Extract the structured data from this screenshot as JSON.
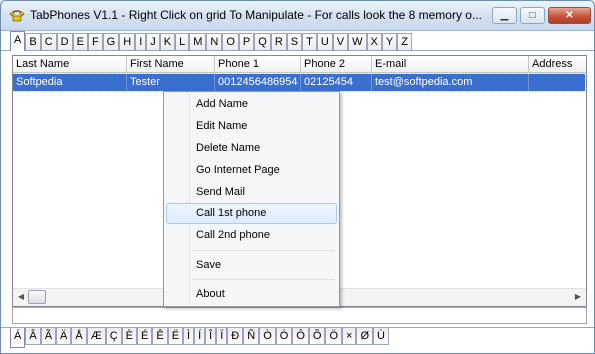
{
  "window": {
    "title": "TabPhones  V1.1  - Right Click on grid To Manipulate - For calls look the 8 memory o...",
    "minimize_label": "▁",
    "maximize_label": "□",
    "close_label": "✕"
  },
  "top_tabs": [
    "A",
    "B",
    "C",
    "D",
    "E",
    "F",
    "G",
    "H",
    "I",
    "J",
    "K",
    "L",
    "M",
    "N",
    "O",
    "P",
    "Q",
    "R",
    "S",
    "T",
    "U",
    "V",
    "W",
    "X",
    "Y",
    "Z"
  ],
  "grid": {
    "columns": [
      "Last Name",
      "First Name",
      "Phone 1",
      "Phone 2",
      "E-mail",
      "Address"
    ],
    "row": [
      "Softpedia",
      "Tester",
      "0012456486954",
      "02125454",
      "test@softpedia.com",
      ""
    ]
  },
  "scrollbar": {
    "left_arrow": "◀",
    "right_arrow": "▶"
  },
  "context_menu": {
    "items": [
      "Add Name",
      "Edit Name",
      "Delete Name",
      "Go Internet Page",
      "Send Mail",
      "Call 1st phone",
      "Call 2nd phone",
      "Save",
      "About"
    ]
  },
  "bottom_tabs": [
    "Á",
    "Â",
    "Ã",
    "Ä",
    "Å",
    "Æ",
    "Ç",
    "È",
    "É",
    "Ê",
    "Ë",
    "Ì",
    "Í",
    "Î",
    "Ï",
    "Ð",
    "Ñ",
    "Ò",
    "Ó",
    "Ô",
    "Õ",
    "Ö",
    "×",
    "Ø",
    "Ù"
  ],
  "colors": {
    "selection": "#3a6fcf",
    "close_button": "#c9543c",
    "menu_hover": "#dcebfc"
  }
}
